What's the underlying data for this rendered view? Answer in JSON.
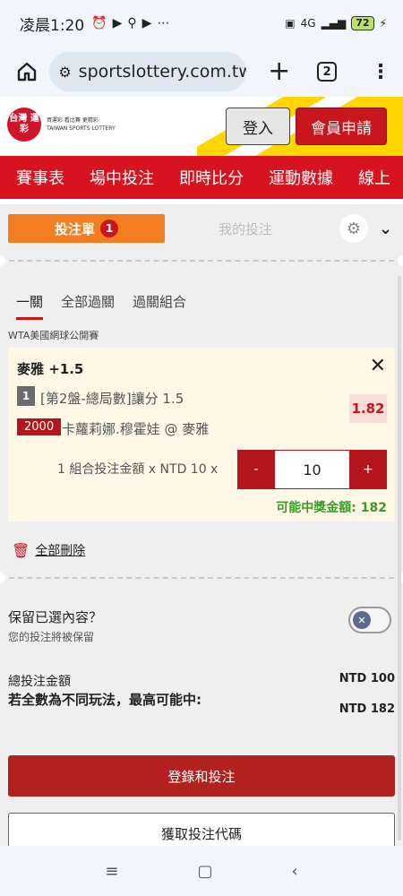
{
  "status_bar": {
    "time": "凌晨1:20",
    "icons": [
      "alarm-icon",
      "youtube-icon",
      "location-icon",
      "youtube-icon",
      "more-icon"
    ],
    "network": "4G",
    "battery": "72"
  },
  "browser": {
    "url": "sportslottery.com.tw/s",
    "tab_count": "2"
  },
  "site_header": {
    "logo_text": "台灣 運彩",
    "logo_tagline_1": "買運彩 看比賽 更精彩",
    "logo_tagline_2": "TAIWAN SPORTS LOTTERY",
    "login_label": "登入",
    "register_label": "會員申請"
  },
  "main_nav": {
    "items": [
      "賽事表",
      "場中投注",
      "即時比分",
      "運動數據",
      "線上"
    ]
  },
  "bet_slip": {
    "tab_active": "投注單",
    "badge_count": "1",
    "tab_mine": "我的投注",
    "modes": [
      "一關",
      "全部過關",
      "過關組合"
    ],
    "league": "WTA美國網球公開賽",
    "selection_title": "麥雅 +1.5",
    "close_symbol": "✕",
    "line_number": "1",
    "market": "[第2盤-總局數]讓分 1.5",
    "odds": "1.82",
    "match_code": "2000",
    "match": "卡蘿莉娜.穆霍娃 @ 麥雅",
    "stake_label": "1 組合投注金額 x NTD 10 x",
    "minus": "-",
    "stake_value": "10",
    "plus": "+",
    "payout": "可能中獎金額: 182",
    "delete_all": "全部刪除",
    "keep_title": "保留已選內容？",
    "keep_sub": "您的投注將被保留",
    "total_label": "總投注金額",
    "total_value": "NTD 100",
    "max_label": "若全數為不同玩法，最高可能中:",
    "max_value": "NTD 182",
    "submit_label": "登錄和投注",
    "code_label": "獲取投注代碼"
  },
  "android_nav": {
    "recent": "≡",
    "home": "▢",
    "back": "‹"
  },
  "colors": {
    "brand_red": "#d6131f",
    "orange": "#f47d20",
    "yellow": "#ffd600",
    "green": "#3c9a28"
  }
}
